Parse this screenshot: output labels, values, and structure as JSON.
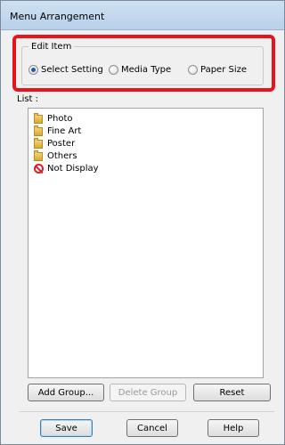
{
  "window": {
    "title": "Menu Arrangement"
  },
  "edit_item": {
    "legend": "Edit Item",
    "options": [
      {
        "label": "Select Setting",
        "checked": true
      },
      {
        "label": "Media Type",
        "checked": false
      },
      {
        "label": "Paper Size",
        "checked": false
      }
    ]
  },
  "list": {
    "label": "List :",
    "items": [
      {
        "label": "Photo",
        "icon": "folder-icon"
      },
      {
        "label": "Fine Art",
        "icon": "folder-icon"
      },
      {
        "label": "Poster",
        "icon": "folder-icon"
      },
      {
        "label": "Others",
        "icon": "folder-icon"
      },
      {
        "label": "Not Display",
        "icon": "no-entry-icon"
      }
    ]
  },
  "buttons": {
    "add_group": "Add Group...",
    "delete_group": "Delete Group",
    "reset": "Reset",
    "save": "Save",
    "cancel": "Cancel",
    "help": "Help"
  },
  "colors": {
    "highlight": "#e8141b",
    "titlebar": "#b9d1ea"
  }
}
